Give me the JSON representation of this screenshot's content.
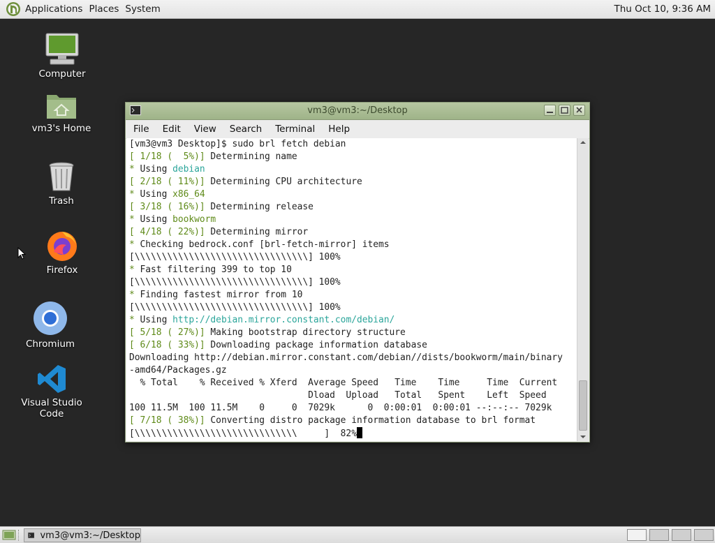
{
  "top_panel": {
    "menus": [
      "Applications",
      "Places",
      "System"
    ],
    "clock": "Thu Oct 10,  9:36 AM"
  },
  "desktop_icons": [
    {
      "label": "Computer",
      "icon": "computer-icon"
    },
    {
      "label": "vm3's Home",
      "icon": "home-folder-icon"
    },
    {
      "label": "Trash",
      "icon": "trash-icon"
    },
    {
      "label": "Firefox",
      "icon": "firefox-icon"
    },
    {
      "label": "Chromium",
      "icon": "chromium-icon"
    },
    {
      "label": "Visual Studio Code",
      "icon": "vscode-icon"
    }
  ],
  "window": {
    "title": "vm3@vm3:~/Desktop",
    "menu": [
      "File",
      "Edit",
      "View",
      "Search",
      "Terminal",
      "Help"
    ]
  },
  "terminal": {
    "lines": [
      [
        {
          "t": "[vm3@vm3 Desktop]$ sudo brl fetch debian"
        }
      ],
      [
        {
          "t": "[ 1/18 (  5%)]",
          "c": "g"
        },
        {
          "t": " Determining name"
        }
      ],
      [
        {
          "t": "*",
          "c": "g"
        },
        {
          "t": " Using "
        },
        {
          "t": "debian",
          "c": "t"
        }
      ],
      [
        {
          "t": "[ 2/18 ( 11%)]",
          "c": "g"
        },
        {
          "t": " Determining CPU architecture"
        }
      ],
      [
        {
          "t": "*",
          "c": "g"
        },
        {
          "t": " Using "
        },
        {
          "t": "x86_64",
          "c": "g"
        }
      ],
      [
        {
          "t": "[ 3/18 ( 16%)]",
          "c": "g"
        },
        {
          "t": " Determining release"
        }
      ],
      [
        {
          "t": "*",
          "c": "g"
        },
        {
          "t": " Using "
        },
        {
          "t": "bookworm",
          "c": "g"
        }
      ],
      [
        {
          "t": "[ 4/18 ( 22%)]",
          "c": "g"
        },
        {
          "t": " Determining mirror"
        }
      ],
      [
        {
          "t": "*",
          "c": "g"
        },
        {
          "t": " Checking bedrock.conf [brl-fetch-mirror] items"
        }
      ],
      [
        {
          "t": "[\\\\\\\\\\\\\\\\\\\\\\\\\\\\\\\\\\\\\\\\\\\\\\\\\\\\\\\\\\\\\\\\] 100%"
        }
      ],
      [
        {
          "t": "*",
          "c": "g"
        },
        {
          "t": " Fast filtering 399 to top 10"
        }
      ],
      [
        {
          "t": "[\\\\\\\\\\\\\\\\\\\\\\\\\\\\\\\\\\\\\\\\\\\\\\\\\\\\\\\\\\\\\\\\] 100%"
        }
      ],
      [
        {
          "t": "*",
          "c": "g"
        },
        {
          "t": " Finding fastest mirror from 10"
        }
      ],
      [
        {
          "t": "[\\\\\\\\\\\\\\\\\\\\\\\\\\\\\\\\\\\\\\\\\\\\\\\\\\\\\\\\\\\\\\\\] 100%"
        }
      ],
      [
        {
          "t": "*",
          "c": "g"
        },
        {
          "t": " Using "
        },
        {
          "t": "http://debian.mirror.constant.com/debian/",
          "c": "t"
        }
      ],
      [
        {
          "t": "[ 5/18 ( 27%)]",
          "c": "g"
        },
        {
          "t": " Making bootstrap directory structure"
        }
      ],
      [
        {
          "t": "[ 6/18 ( 33%)]",
          "c": "g"
        },
        {
          "t": " Downloading package information database"
        }
      ],
      [
        {
          "t": "Downloading http://debian.mirror.constant.com/debian//dists/bookworm/main/binary"
        }
      ],
      [
        {
          "t": "-amd64/Packages.gz"
        }
      ],
      [
        {
          "t": "  % Total    % Received % Xferd  Average Speed   Time    Time     Time  Current"
        }
      ],
      [
        {
          "t": "                                 Dload  Upload   Total   Spent    Left  Speed"
        }
      ],
      [
        {
          "t": "100 11.5M  100 11.5M    0     0  7029k      0  0:00:01  0:00:01 --:--:-- 7029k"
        }
      ],
      [
        {
          "t": "[ 7/18 ( 38%)]",
          "c": "g"
        },
        {
          "t": " Converting distro package information database to brl format"
        }
      ],
      [
        {
          "t": "[\\\\\\\\\\\\\\\\\\\\\\\\\\\\\\\\\\\\\\\\\\\\\\\\\\\\\\\\\\\\     ]  82%"
        }
      ]
    ]
  },
  "taskbar": {
    "task_label": "vm3@vm3:~/Desktop"
  },
  "colors": {
    "desktop_bg": "#262626",
    "title_bar": "#a9bb92",
    "term_green": "#5e8a18",
    "term_teal": "#2aa59a"
  }
}
